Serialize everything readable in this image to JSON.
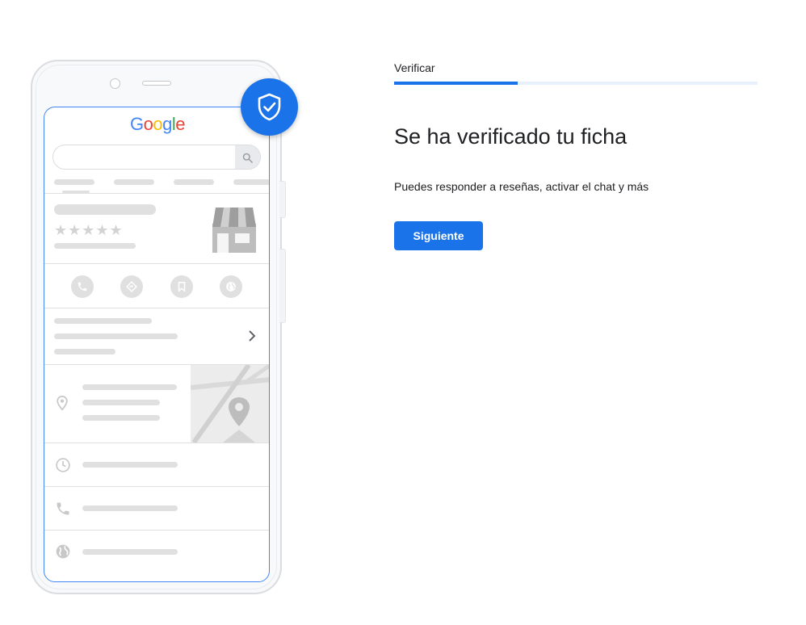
{
  "step": {
    "label": "Verificar",
    "progress_fraction": 0.34
  },
  "content": {
    "title": "Se ha verificado tu ficha",
    "subtitle": "Puedes responder a reseñas, activar el chat y más",
    "next_button": "Siguiente"
  },
  "illustration": {
    "logo_letters": [
      "G",
      "o",
      "o",
      "g",
      "l",
      "e"
    ],
    "logo_colors": [
      "#4285F4",
      "#EA4335",
      "#FBBC05",
      "#4285F4",
      "#34A853",
      "#EA4335"
    ],
    "stars": "★★★★★",
    "chevron": "›",
    "icons": [
      "shield-check-icon",
      "search-icon",
      "storefront-icon",
      "phone-icon",
      "directions-icon",
      "bookmark-icon",
      "globe-icon",
      "chevron-right-icon",
      "location-pin-icon",
      "map-pin-icon",
      "clock-icon"
    ]
  },
  "colors": {
    "accent": "#1a73e8",
    "track": "#e8f0fe",
    "placeholder": "#e0e0e0"
  }
}
